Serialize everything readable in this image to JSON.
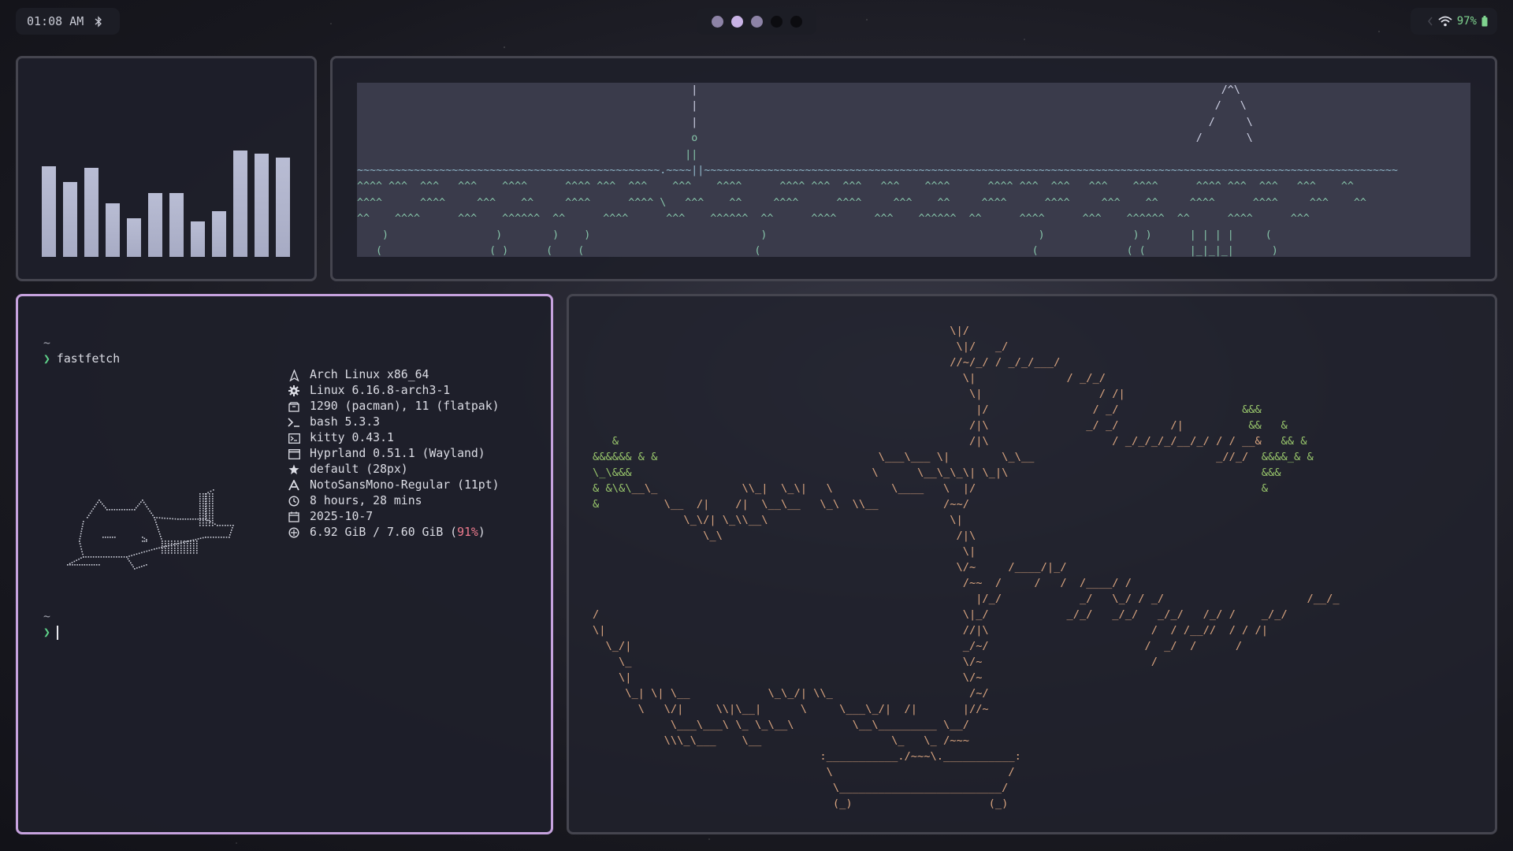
{
  "topbar": {
    "clock": "01:08 AM",
    "bluetooth_icon": "bluetooth-icon",
    "workspaces": [
      {
        "state": "occupied"
      },
      {
        "state": "active"
      },
      {
        "state": "occupied"
      },
      {
        "state": "empty"
      },
      {
        "state": "empty"
      }
    ],
    "battery_percent": "97%",
    "wifi_icon": "wifi-icon",
    "battery_icon": "battery-icon",
    "accent_color": "#7fd38f"
  },
  "visualizer": {
    "levels": [
      0.64,
      0.53,
      0.63,
      0.38,
      0.27,
      0.45,
      0.45,
      0.25,
      0.32,
      0.75,
      0.73,
      0.7
    ]
  },
  "terminal": {
    "cwd": "~",
    "command": "fastfetch",
    "info": [
      {
        "icon": "linux-icon",
        "text": "Arch Linux x86_64"
      },
      {
        "icon": "gear-icon",
        "text": "Linux 6.16.8-arch3-1"
      },
      {
        "icon": "package-icon",
        "text": "1290 (pacman), 11 (flatpak)"
      },
      {
        "icon": "shell-icon",
        "text": "bash 5.3.3"
      },
      {
        "icon": "terminal-icon",
        "text": "kitty 0.43.1"
      },
      {
        "icon": "window-icon",
        "text": "Hyprland 0.51.1 (Wayland)"
      },
      {
        "icon": "star-icon",
        "text": "default (28px)"
      },
      {
        "icon": "font-icon",
        "text": "NotoSansMono-Regular (11pt)"
      },
      {
        "icon": "clock-icon",
        "text": "8 hours, 28 mins"
      },
      {
        "icon": "calendar-icon",
        "text": "2025-10-7"
      }
    ],
    "memory_text": "6.92 GiB / 7.60 GiB (",
    "memory_percent": "91%",
    "memory_close": ")",
    "cwd2": "~",
    "prompt_symbol": "❯"
  }
}
